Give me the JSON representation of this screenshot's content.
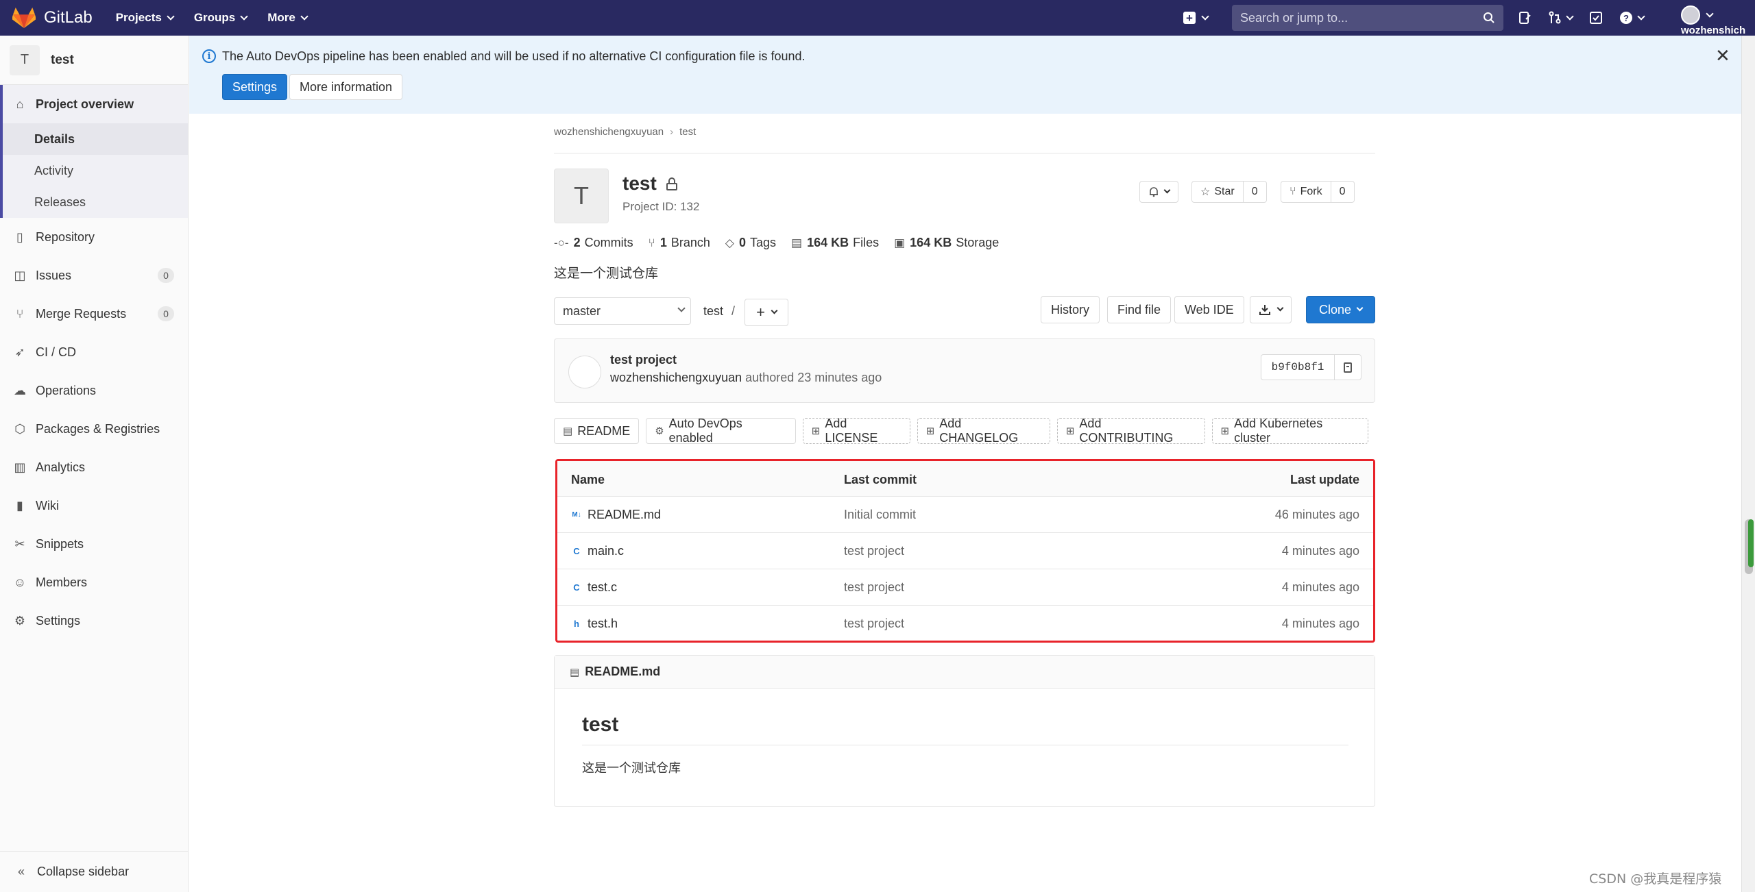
{
  "navbar": {
    "brand": "GitLab",
    "menus": [
      "Projects",
      "Groups",
      "More"
    ],
    "search_placeholder": "Search or jump to...",
    "user": "wozhenshich",
    "icons": [
      "plus-square-icon",
      "search-icon",
      "todo-icon",
      "merge-request-icon",
      "check-icon",
      "help-icon"
    ]
  },
  "sidebar": {
    "project_letter": "T",
    "project_name": "test",
    "overview": {
      "label": "Project overview",
      "subs": [
        "Details",
        "Activity",
        "Releases"
      ]
    },
    "items": [
      {
        "label": "Repository",
        "icon": "repository-icon"
      },
      {
        "label": "Issues",
        "icon": "issues-icon",
        "count": "0"
      },
      {
        "label": "Merge Requests",
        "icon": "merge-request-icon",
        "count": "0"
      },
      {
        "label": "CI / CD",
        "icon": "rocket-icon"
      },
      {
        "label": "Operations",
        "icon": "cloud-icon"
      },
      {
        "label": "Packages & Registries",
        "icon": "package-icon"
      },
      {
        "label": "Analytics",
        "icon": "chart-icon"
      },
      {
        "label": "Wiki",
        "icon": "book-icon"
      },
      {
        "label": "Snippets",
        "icon": "scissors-icon"
      },
      {
        "label": "Members",
        "icon": "users-icon"
      },
      {
        "label": "Settings",
        "icon": "gear-icon"
      }
    ],
    "collapse": "Collapse sidebar"
  },
  "banner": {
    "text": "The Auto DevOps pipeline has been enabled and will be used if no alternative CI configuration file is found.",
    "settings": "Settings",
    "more_info": "More information"
  },
  "breadcrumb": [
    "wozhenshichengxuyuan",
    "test"
  ],
  "project": {
    "letter": "T",
    "name": "test",
    "id_text": "Project ID: 132",
    "star": "Star",
    "star_count": "0",
    "fork": "Fork",
    "fork_count": "0",
    "description": "这是一个测试仓库"
  },
  "stats": [
    {
      "value": "2",
      "label": "Commits",
      "icon": "commit-icon"
    },
    {
      "value": "1",
      "label": "Branch",
      "icon": "branch-icon"
    },
    {
      "value": "0",
      "label": "Tags",
      "icon": "tag-icon"
    },
    {
      "value": "164 KB",
      "label": "Files",
      "icon": "file-icon"
    },
    {
      "value": "164 KB",
      "label": "Storage",
      "icon": "storage-icon"
    }
  ],
  "toolbar": {
    "branch": "master",
    "path": "test",
    "history": "History",
    "find_file": "Find file",
    "web_ide": "Web IDE",
    "clone": "Clone"
  },
  "last_commit": {
    "title": "test project",
    "author": "wozhenshichengxuyuan",
    "authored": "authored 23 minutes ago",
    "sha": "b9f0b8f1"
  },
  "quick_buttons": [
    {
      "label": "README",
      "dashed": false
    },
    {
      "label": "Auto DevOps enabled",
      "dashed": false
    },
    {
      "label": "Add LICENSE",
      "dashed": true
    },
    {
      "label": "Add CHANGELOG",
      "dashed": true
    },
    {
      "label": "Add CONTRIBUTING",
      "dashed": true
    },
    {
      "label": "Add Kubernetes cluster",
      "dashed": true
    }
  ],
  "file_table": {
    "headers": [
      "Name",
      "Last commit",
      "Last update"
    ],
    "rows": [
      {
        "icon": "M↓",
        "name": "README.md",
        "commit": "Initial commit",
        "updated": "46 minutes ago"
      },
      {
        "icon": "C",
        "name": "main.c",
        "commit": "test project",
        "updated": "4 minutes ago"
      },
      {
        "icon": "C",
        "name": "test.c",
        "commit": "test project",
        "updated": "4 minutes ago"
      },
      {
        "icon": "h",
        "name": "test.h",
        "commit": "test project",
        "updated": "4 minutes ago"
      }
    ]
  },
  "readme": {
    "file": "README.md",
    "heading": "test",
    "body": "这是一个测试仓库"
  },
  "watermark": "CSDN @我真是程序猿"
}
